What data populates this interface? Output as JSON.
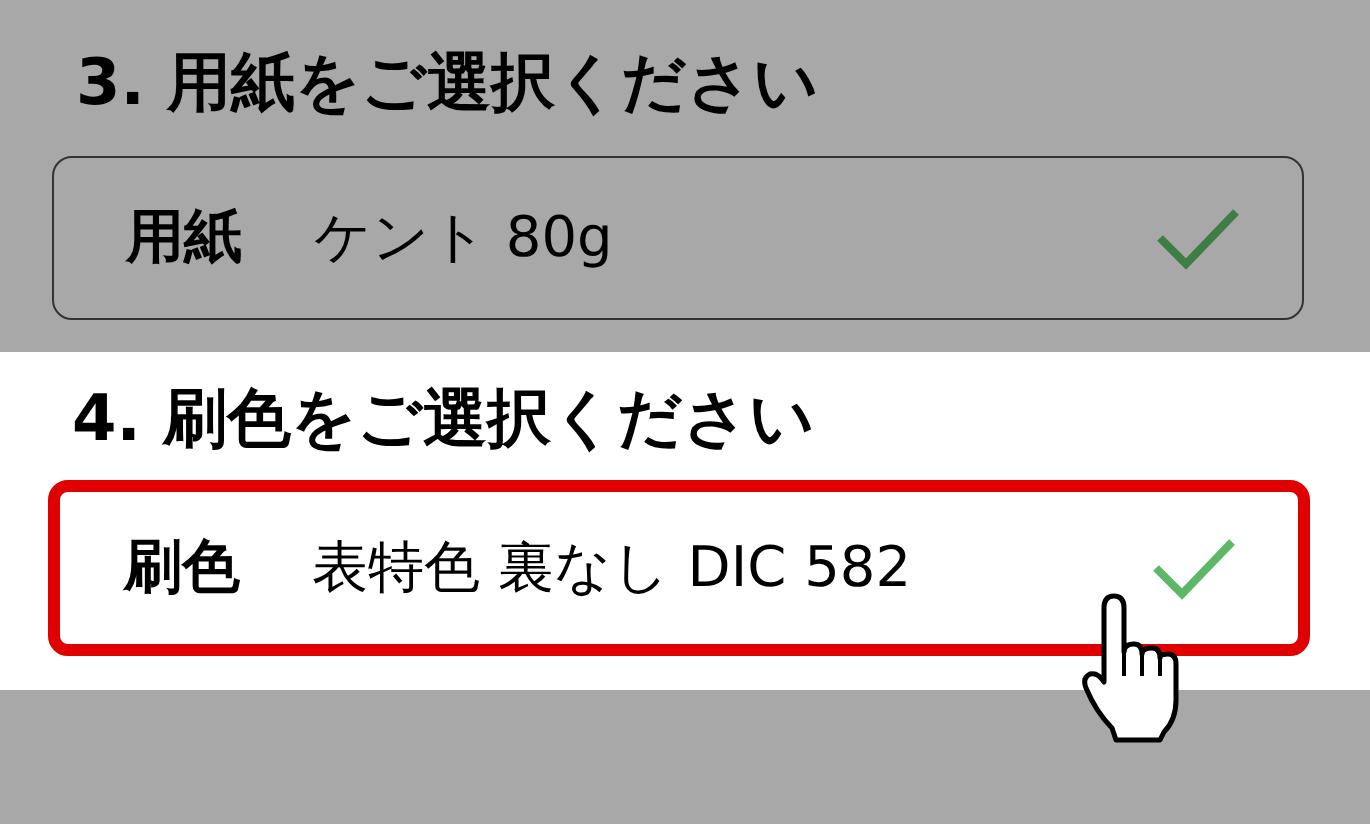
{
  "steps": [
    {
      "heading": "3. 用紙をご選択ください",
      "label": "用紙",
      "value": "ケント 80g",
      "dimmed": true,
      "highlighted": false,
      "checked": true,
      "pointer": false
    },
    {
      "heading": "4. 刷色をご選択ください",
      "label": "刷色",
      "value": "表特色 裏なし DIC 582",
      "dimmed": false,
      "highlighted": true,
      "checked": true,
      "pointer": true
    }
  ]
}
